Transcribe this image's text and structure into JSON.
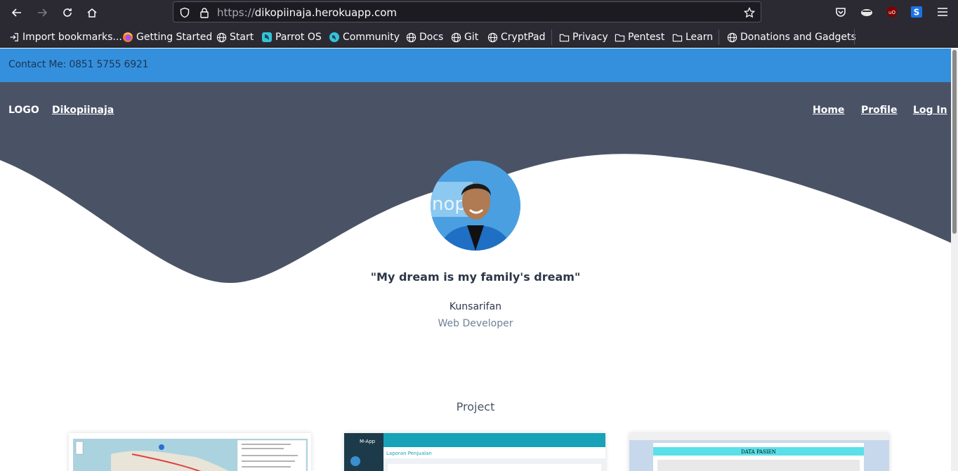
{
  "browser": {
    "url_scheme": "https://",
    "url_host": "dikopiinaja.herokuapp.com",
    "bookmarks": [
      {
        "label": "Import bookmarks...",
        "icon": "import-icon"
      },
      {
        "label": "Getting Started",
        "icon": "firefox-icon"
      },
      {
        "label": "Start",
        "icon": "globe-icon"
      },
      {
        "label": "Parrot OS",
        "icon": "parrot-icon"
      },
      {
        "label": "Community",
        "icon": "community-icon"
      },
      {
        "label": "Docs",
        "icon": "globe-icon"
      },
      {
        "label": "Git",
        "icon": "globe-icon"
      },
      {
        "label": "CryptPad",
        "icon": "globe-icon"
      },
      {
        "label": "Privacy",
        "icon": "folder-icon"
      },
      {
        "label": "Pentest",
        "icon": "folder-icon"
      },
      {
        "label": "Learn",
        "icon": "folder-icon"
      },
      {
        "label": "Donations and Gadgets",
        "icon": "globe-icon"
      }
    ]
  },
  "site": {
    "contact": "Contact Me: 0851 5755 6921",
    "logo": "LOGO",
    "brand": "Dikopiinaja",
    "nav": [
      "Home",
      "Profile",
      "Log In"
    ],
    "quote": "\"My dream is my family's dream\"",
    "name": "Kunsarifan",
    "role": "Web Developer",
    "section_title": "Project",
    "card2_app": "M-App",
    "card2_heading": "Laporan Penjualan",
    "card3_heading": "DATA PASIEN"
  },
  "colors": {
    "contact_bar": "#3490dc",
    "header": "#4a5366",
    "text_dark": "#2d3748"
  }
}
